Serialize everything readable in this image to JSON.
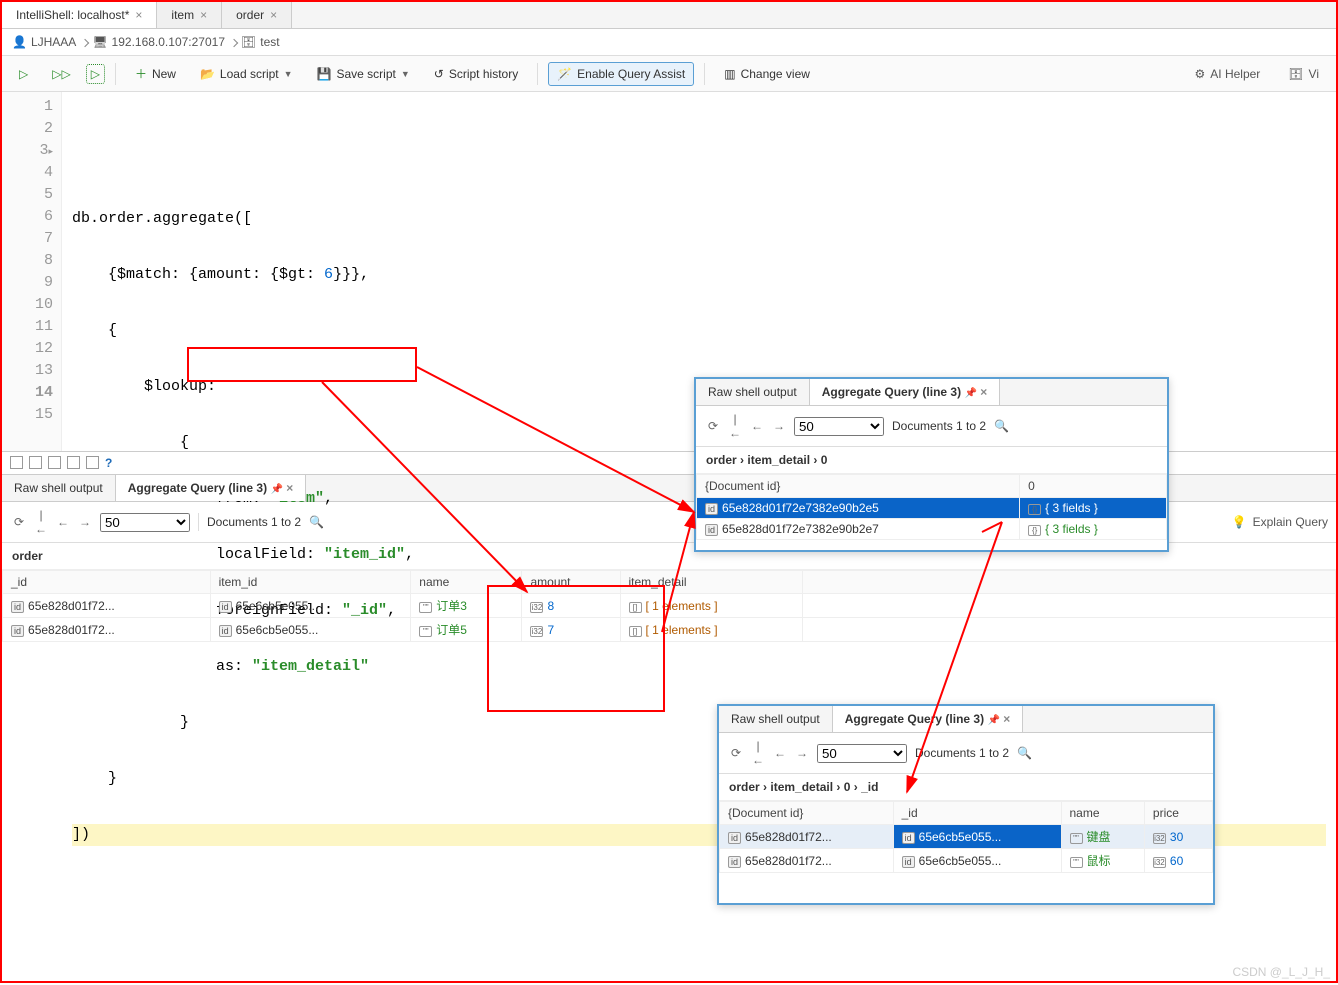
{
  "tabs": {
    "t0": "IntelliShell: localhost*",
    "t1": "item",
    "t2": "order"
  },
  "breadcrumb": {
    "user": "LJHAAA",
    "host": "192.168.0.107:27017",
    "db": "test"
  },
  "toolbar": {
    "new": "New",
    "load": "Load script",
    "save": "Save script",
    "history": "Script history",
    "assist": "Enable Query Assist",
    "changeview": "Change view",
    "ai": "AI Helper",
    "vis": "Vi"
  },
  "code": {
    "l3": "db.order.aggregate([",
    "l4": "    {$match: {amount: {$gt: ",
    "l4n": "6",
    "l4e": "}}},",
    "l5": "    {",
    "l6": "        $lookup:",
    "l7": "            {",
    "l8a": "                from: ",
    "l8s": "\"item\"",
    "l8e": ",",
    "l9a": "                localField: ",
    "l9s": "\"item_id\"",
    "l9e": ",",
    "l10a": "                foreignField: ",
    "l10s": "\"_id\"",
    "l10e": ",",
    "l11a": "                as: ",
    "l11s": "\"item_detail\"",
    "l12": "            }",
    "l13": "    }",
    "l14": "])"
  },
  "panel": {
    "raw": "Raw shell output",
    "agg": "Aggregate Query (line 3)"
  },
  "panelbar": {
    "page": "50",
    "range": "Documents 1 to 2",
    "explain": "Explain Query"
  },
  "mainpath": "order",
  "cols": {
    "id": "_id",
    "item": "item_id",
    "name": "name",
    "amount": "amount",
    "detail": "item_detail"
  },
  "rows": [
    {
      "id": "65e828d01f72...",
      "item": "65e6cb5e055...",
      "name": "订单3",
      "amount": "8",
      "detail": "[ 1 elements ]"
    },
    {
      "id": "65e828d01f72...",
      "item": "65e6cb5e055...",
      "name": "订单5",
      "amount": "7",
      "detail": "[ 1 elements ]"
    }
  ],
  "pop1": {
    "path": {
      "a": "order",
      "b": "item_detail",
      "c": "0"
    },
    "hcol1": "{Document id}",
    "hcol2": "0",
    "r": [
      {
        "id": "65e828d01f72e7382e90b2e5",
        "v": "{ 3 fields }"
      },
      {
        "id": "65e828d01f72e7382e90b2e7",
        "v": "{ 3 fields }"
      }
    ]
  },
  "pop2": {
    "path": {
      "a": "order",
      "b": "item_detail",
      "c": "0",
      "d": "_id"
    },
    "h": {
      "c1": "{Document id}",
      "c2": "_id",
      "c3": "name",
      "c4": "price"
    },
    "r": [
      {
        "id": "65e828d01f72...",
        "sid": "65e6cb5e055...",
        "name": "键盘",
        "price": "30"
      },
      {
        "id": "65e828d01f72...",
        "sid": "65e6cb5e055...",
        "name": "鼠标",
        "price": "60"
      }
    ]
  },
  "watermark": "CSDN @_L_J_H_"
}
